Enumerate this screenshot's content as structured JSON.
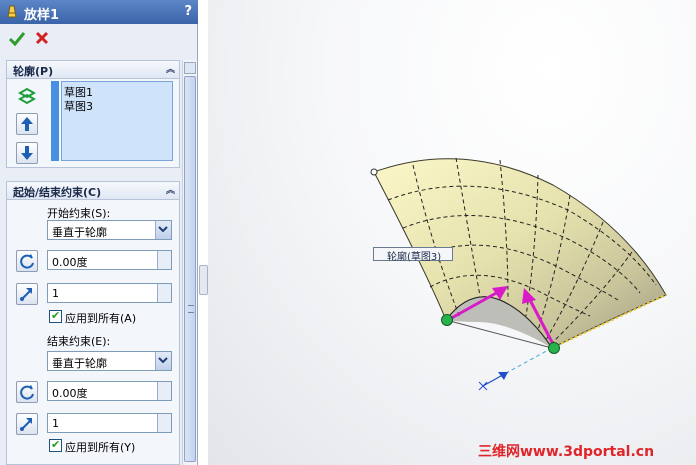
{
  "panel": {
    "title": "放样1",
    "help": "?",
    "icons": {
      "title": "loft-icon",
      "ok": "checkmark-icon",
      "cancel": "x-icon"
    }
  },
  "profile_group": {
    "header": "轮廓(P)",
    "items": [
      "草图1",
      "草图3"
    ]
  },
  "constraint_group": {
    "header": "起始/结束约束(C)",
    "start_label": "开始约束(S):",
    "start_value": "垂直于轮廓",
    "start_angle": "0.00度",
    "start_length": "1",
    "start_apply_all": "应用到所有(A)",
    "end_label": "结束约束(E):",
    "end_value": "垂直于轮廓",
    "end_angle": "0.00度",
    "end_length": "1",
    "end_apply_all": "应用到所有(Y)"
  },
  "viewport": {
    "callout": "轮廓(草图3)",
    "watermark": "三维网www.3dportal.cn"
  },
  "colors": {
    "accent": "#4a90e2",
    "arrow": "#d81ac8",
    "point": "#28b24b",
    "watermark": "#e0252a"
  }
}
